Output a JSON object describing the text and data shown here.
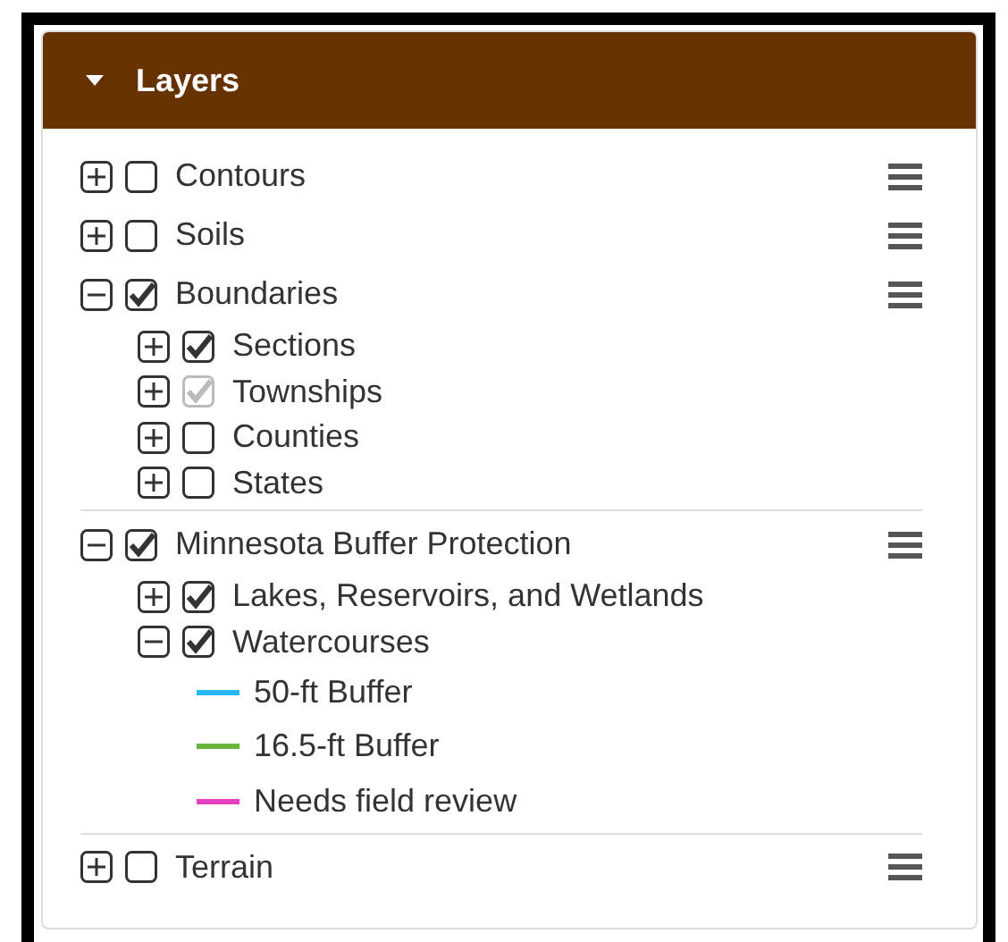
{
  "panel": {
    "title": "Layers",
    "expanded": true
  },
  "layers": [
    {
      "name": "Contours",
      "expanded": false,
      "checked": false,
      "disabled": false,
      "menu": true
    },
    {
      "name": "Soils",
      "expanded": false,
      "checked": false,
      "disabled": false,
      "menu": true
    },
    {
      "name": "Boundaries",
      "expanded": true,
      "checked": true,
      "disabled": false,
      "menu": true,
      "children": [
        {
          "name": "Sections",
          "expanded": false,
          "checked": true,
          "disabled": false
        },
        {
          "name": "Townships",
          "expanded": false,
          "checked": true,
          "disabled": true
        },
        {
          "name": "Counties",
          "expanded": false,
          "checked": false,
          "disabled": false
        },
        {
          "name": "States",
          "expanded": false,
          "checked": false,
          "disabled": false
        }
      ]
    },
    {
      "name": "Minnesota Buffer Protection",
      "expanded": true,
      "checked": true,
      "disabled": false,
      "menu": true,
      "children": [
        {
          "name": "Lakes, Reservoirs, and Wetlands",
          "expanded": false,
          "checked": true,
          "disabled": false
        },
        {
          "name": "Watercourses",
          "expanded": true,
          "checked": true,
          "disabled": false,
          "legend": [
            {
              "label": "50-ft Buffer",
              "color": "#29b6f6"
            },
            {
              "label": "16.5-ft Buffer",
              "color": "#6ab43e"
            },
            {
              "label": "Needs field review",
              "color": "#e83fc0"
            }
          ]
        }
      ]
    },
    {
      "name": "Terrain",
      "expanded": false,
      "checked": false,
      "disabled": false,
      "menu": true
    }
  ]
}
